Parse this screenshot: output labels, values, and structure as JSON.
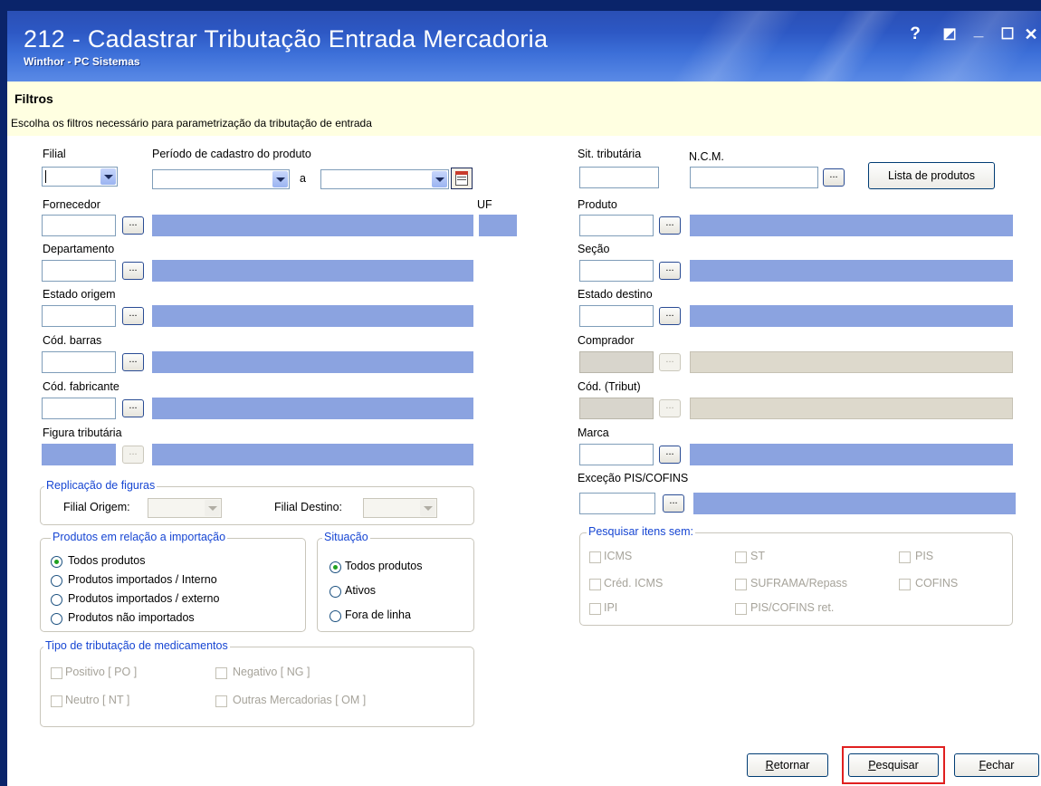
{
  "window": {
    "title": "212 - Cadastrar Tributação Entrada Mercadoria",
    "subtitle": "Winthor - PC Sistemas",
    "controls": [
      "?",
      "◩",
      "_",
      "☐",
      "✕"
    ]
  },
  "filters": {
    "title": "Filtros",
    "description": "Escolha os filtros necessário para parametrização da tributação de entrada"
  },
  "left": {
    "filial_label": "Filial",
    "periodo_label": "Período de cadastro do produto",
    "periodo_sep": "a",
    "fornecedor_label": "Fornecedor",
    "uf_label": "UF",
    "departamento_label": "Departamento",
    "estado_origem_label": "Estado origem",
    "cod_barras_label": "Cód. barras",
    "cod_fabricante_label": "Cód. fabricante",
    "figura_tributaria_label": "Figura tributária"
  },
  "right": {
    "sit_tributaria_label": "Sit. tributária",
    "ncm_label": "N.C.M.",
    "lista_produtos_button": "Lista de produtos",
    "produto_label": "Produto",
    "secao_label": "Seção",
    "estado_destino_label": "Estado destino",
    "comprador_label": "Comprador",
    "cod_tribut_label": "Cód. (Tribut)",
    "marca_label": "Marca",
    "excecao_label": "Exceção PIS/COFINS"
  },
  "dots_label": "...",
  "replicacao": {
    "title": "Replicação de figuras",
    "filial_origem_label": "Filial Origem:",
    "filial_destino_label": "Filial Destino:"
  },
  "importacao": {
    "title": "Produtos em relação a importação",
    "options": [
      "Todos produtos",
      "Produtos importados / Interno",
      "Produtos importados / externo",
      "Produtos não importados"
    ],
    "selected": 0
  },
  "situacao": {
    "title": "Situação",
    "options": [
      "Todos produtos",
      "Ativos",
      "Fora de linha"
    ],
    "selected": 0
  },
  "medicamentos": {
    "title": "Tipo de tributação de medicamentos",
    "options": [
      "Positivo [ PO ]",
      "Negativo [ NG ]",
      "Neutro [ NT ]",
      "Outras Mercadorias [ OM ]"
    ]
  },
  "pesquisar_sem": {
    "title": "Pesquisar itens sem:",
    "options": [
      "ICMS",
      "ST",
      "PIS",
      "Créd. ICMS",
      "SUFRAMA/Repass",
      "COFINS",
      "IPI",
      "PIS/COFINS ret."
    ]
  },
  "buttons": {
    "retornar_first": "R",
    "retornar_rest": "etornar",
    "pesquisar_first": "P",
    "pesquisar_rest": "esquisar",
    "fechar_first": "F",
    "fechar_rest": "echar"
  },
  "colors": {
    "titlebar": "#2d58c4",
    "filter_bg": "#ffffe1",
    "lookup_blue": "#8ba3e0",
    "group_title": "#1746d3",
    "highlight": "#e02020"
  }
}
